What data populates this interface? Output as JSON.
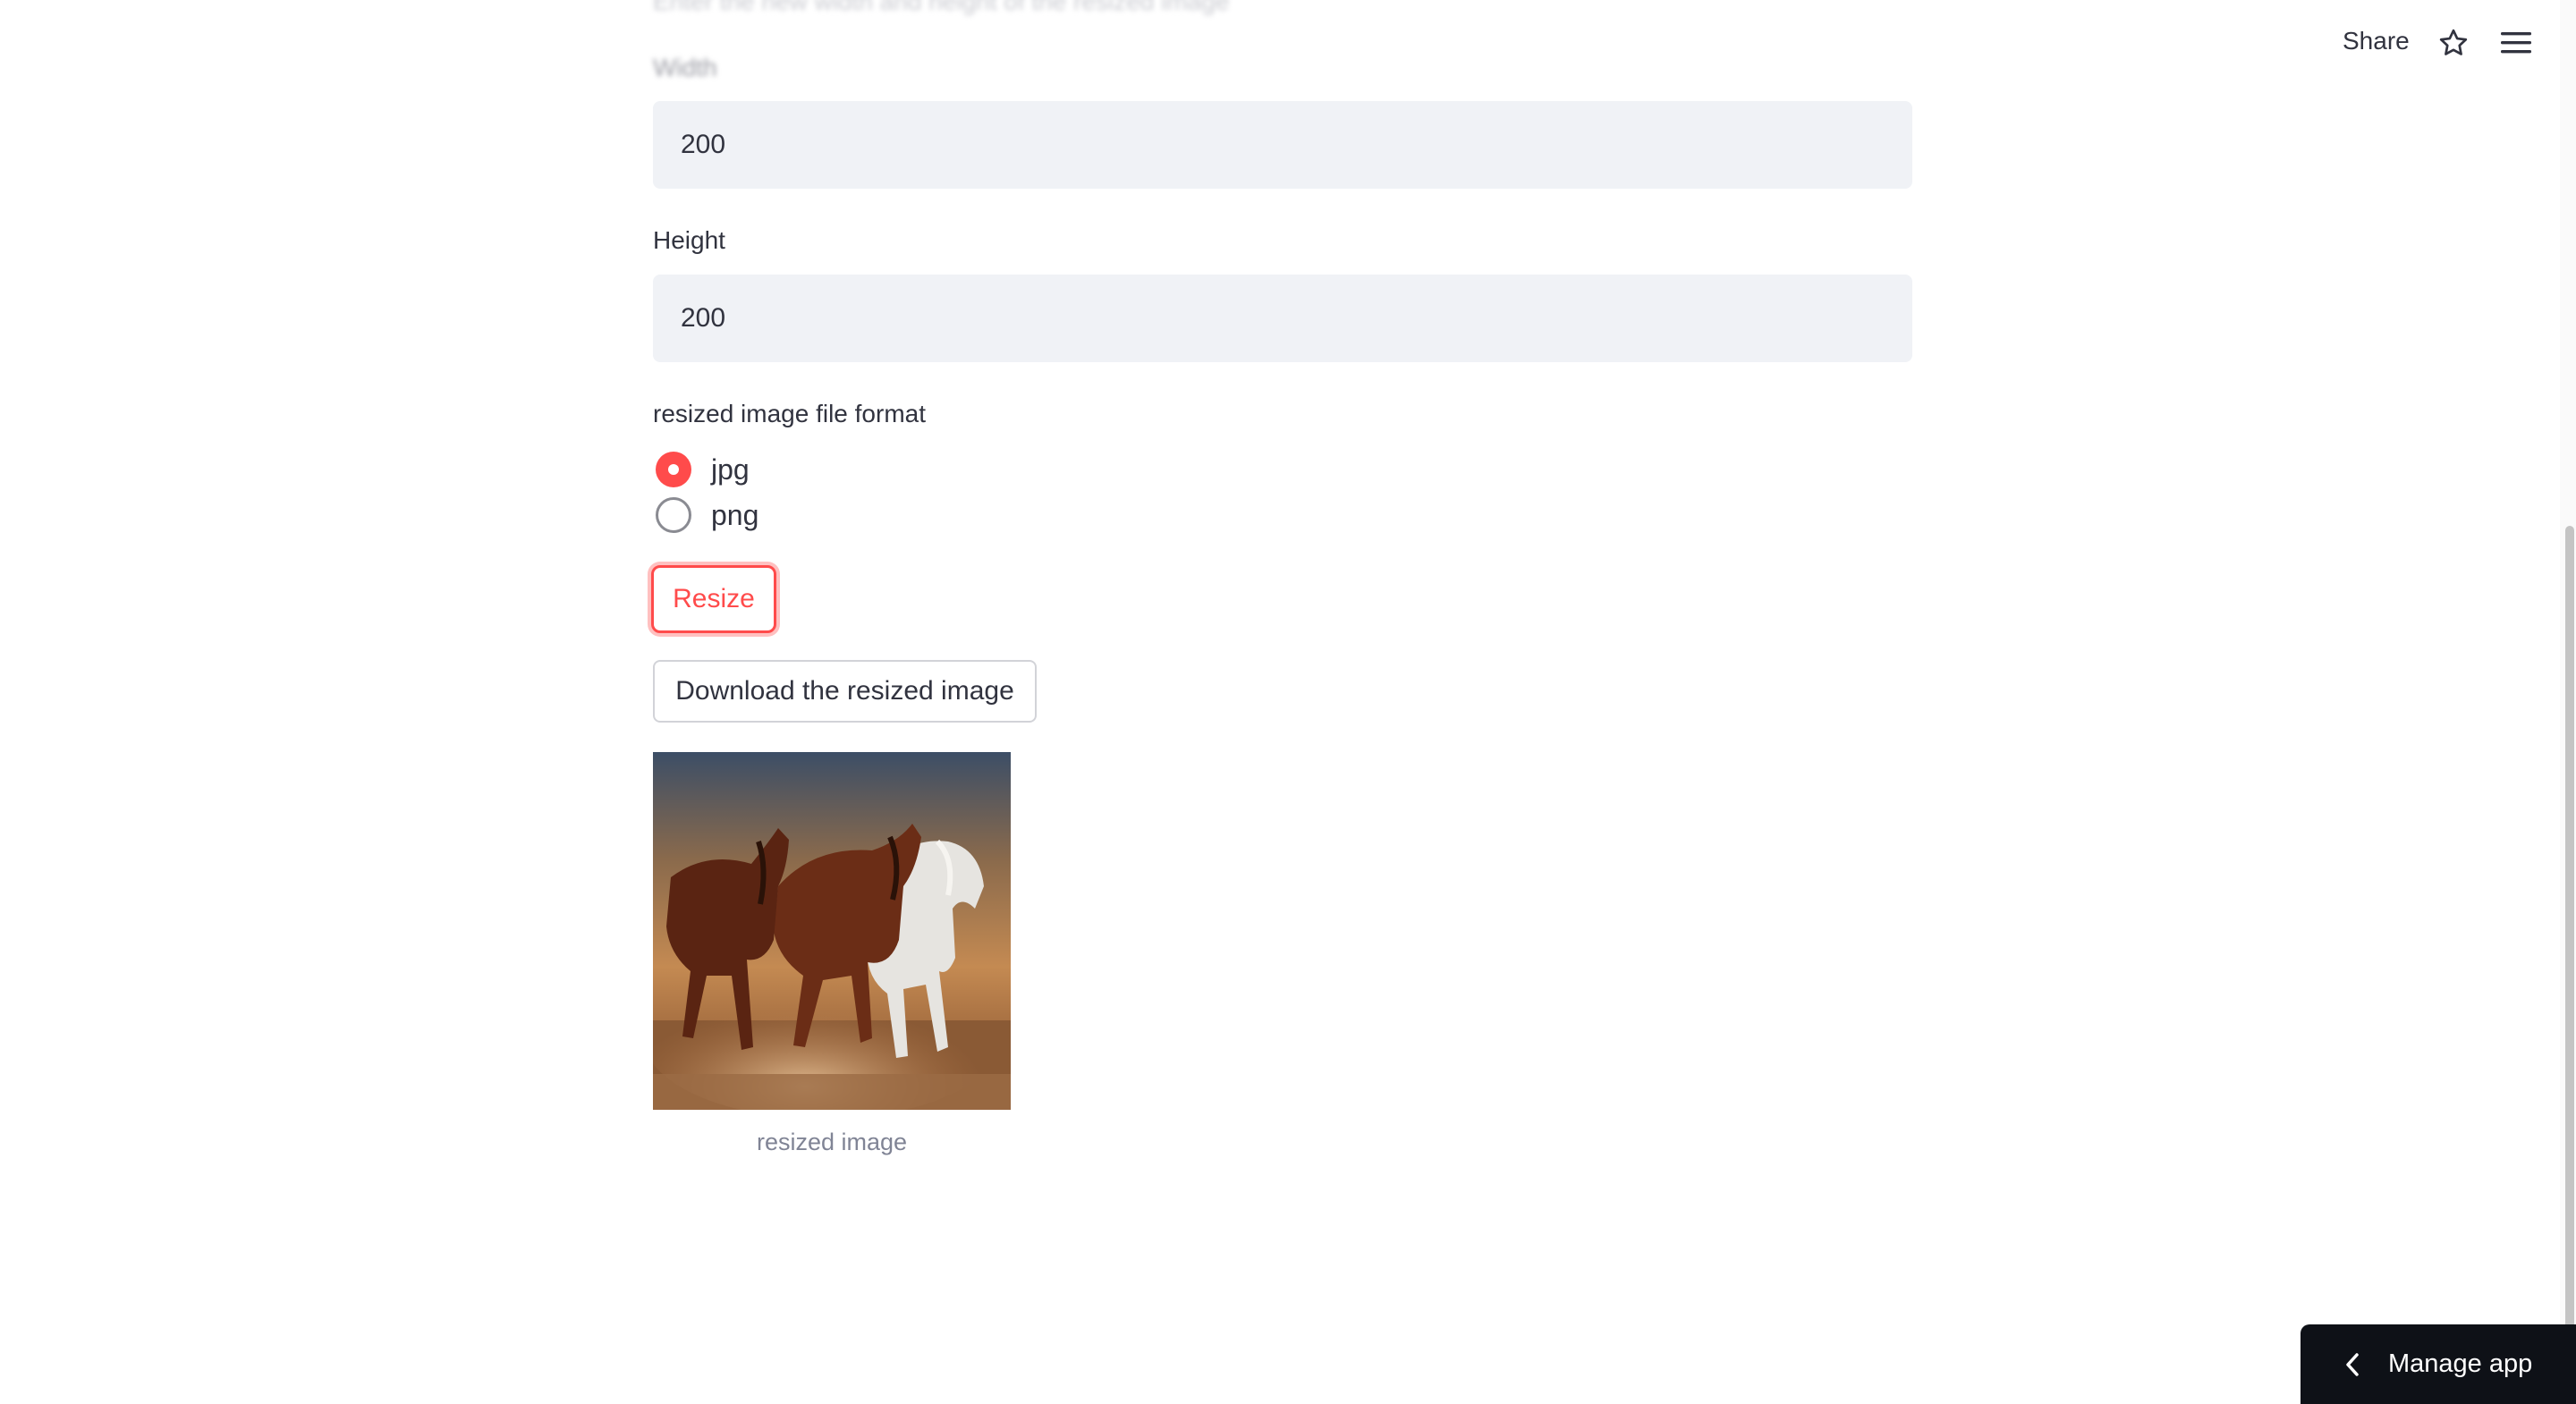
{
  "form": {
    "faded_description": "Enter the new width and height of the resized image",
    "width_label": "Width",
    "width_value": "200",
    "height_label": "Height",
    "height_value": "200",
    "format_label": "resized image file format",
    "format_options": [
      {
        "label": "jpg",
        "selected": true
      },
      {
        "label": "png",
        "selected": false
      }
    ],
    "resize_button": "Resize",
    "download_button": "Download the resized image",
    "image_caption": "resized image"
  },
  "header": {
    "share_label": "Share",
    "icons": [
      "star-icon",
      "hamburger-menu-icon"
    ]
  },
  "footer": {
    "manage_app_label": "Manage app",
    "icon": "chevron-left-icon"
  },
  "colors": {
    "accent": "#ff4b4b",
    "field_bg": "#f0f2f6",
    "manage_bg": "#0e1117",
    "text": "#31333f",
    "caption": "#808495"
  }
}
